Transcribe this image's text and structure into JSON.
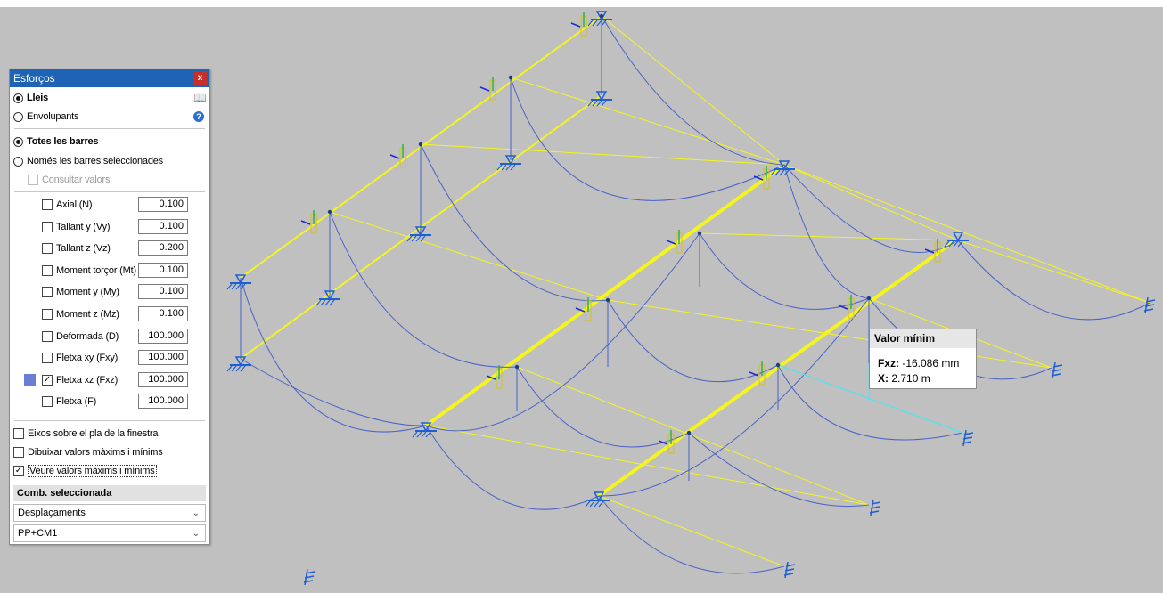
{
  "panel": {
    "title": "Esforços",
    "close": "x",
    "radio_lleis": "Lleis",
    "radio_envolupants": "Envolupants",
    "radio_totes": "Totes les barres",
    "radio_nomes": "Només les barres seleccionades",
    "consultar": "Consultar valors",
    "items": [
      {
        "label": "Axial (N)",
        "value": "0.100",
        "checked": false
      },
      {
        "label": "Tallant y (Vy)",
        "value": "0.100",
        "checked": false
      },
      {
        "label": "Tallant z (Vz)",
        "value": "0.200",
        "checked": false
      },
      {
        "label": "Moment torçor (Mt)",
        "value": "0.100",
        "checked": false
      },
      {
        "label": "Moment y (My)",
        "value": "0.100",
        "checked": false
      },
      {
        "label": "Moment z (Mz)",
        "value": "0.100",
        "checked": false
      },
      {
        "label": "Deformada (D)",
        "value": "100.000",
        "checked": false
      },
      {
        "label": "Fletxa xy (Fxy)",
        "value": "100.000",
        "checked": false
      },
      {
        "label": "Fletxa xz (Fxz)",
        "value": "100.000",
        "checked": true
      },
      {
        "label": "Fletxa (F)",
        "value": "100.000",
        "checked": false
      }
    ],
    "opt_eixos": "Eixos sobre el pla de la finestra",
    "opt_dibuixar": "Dibuixar valors màxims i mínims",
    "opt_veure": "Veure valors màxims i mínims",
    "comb_header": "Comb. seleccionada",
    "combo1": "Desplaçaments",
    "combo2": "PP+CM1",
    "swatch_color": "#6a7fd1"
  },
  "tooltip": {
    "title": "Valor mínim",
    "line1_key": "Fxz:",
    "line1_val": " -16.086 mm",
    "line2_key": "X:",
    "line2_val": " 2.710 m"
  },
  "colors": {
    "viewport_bg": "#c0c0c0",
    "beam": "#f5f51e",
    "curve": "#4a62c8",
    "support": "#1c5fd6",
    "highlight": "#5fe0e8"
  }
}
